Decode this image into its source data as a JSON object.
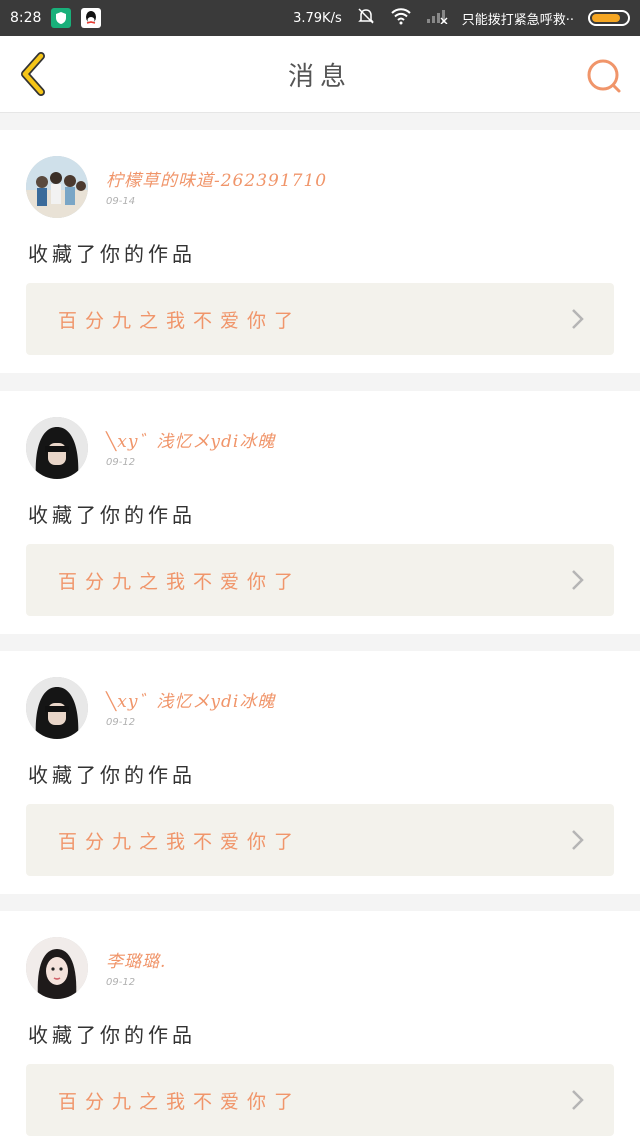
{
  "status_bar": {
    "time": "8:28",
    "net_speed": "3.79K/s",
    "carrier": "只能拨打紧急呼救··",
    "battery_level": 0.82
  },
  "header": {
    "title": "消息"
  },
  "colors": {
    "accent": "#f0956a",
    "back_icon": "#f5c518",
    "card_link_bg": "#f3f2ec"
  },
  "messages": [
    {
      "username": "柠檬草的味道-262391710",
      "date": "09-14",
      "action": "收藏了你的作品",
      "work_title": "百分九之我不爱你了",
      "avatar_icon": "group-photo-avatar"
    },
    {
      "username": "╲xy゛浅忆メydi冰魄",
      "date": "09-12",
      "action": "收藏了你的作品",
      "work_title": "百分九之我不爱你了",
      "avatar_icon": "dark-hair-avatar"
    },
    {
      "username": "╲xy゛浅忆メydi冰魄",
      "date": "09-12",
      "action": "收藏了你的作品",
      "work_title": "百分九之我不爱你了",
      "avatar_icon": "dark-hair-avatar"
    },
    {
      "username": "李璐璐.",
      "date": "09-12",
      "action": "收藏了你的作品",
      "work_title": "百分九之我不爱你了",
      "avatar_icon": "portrait-avatar"
    }
  ]
}
